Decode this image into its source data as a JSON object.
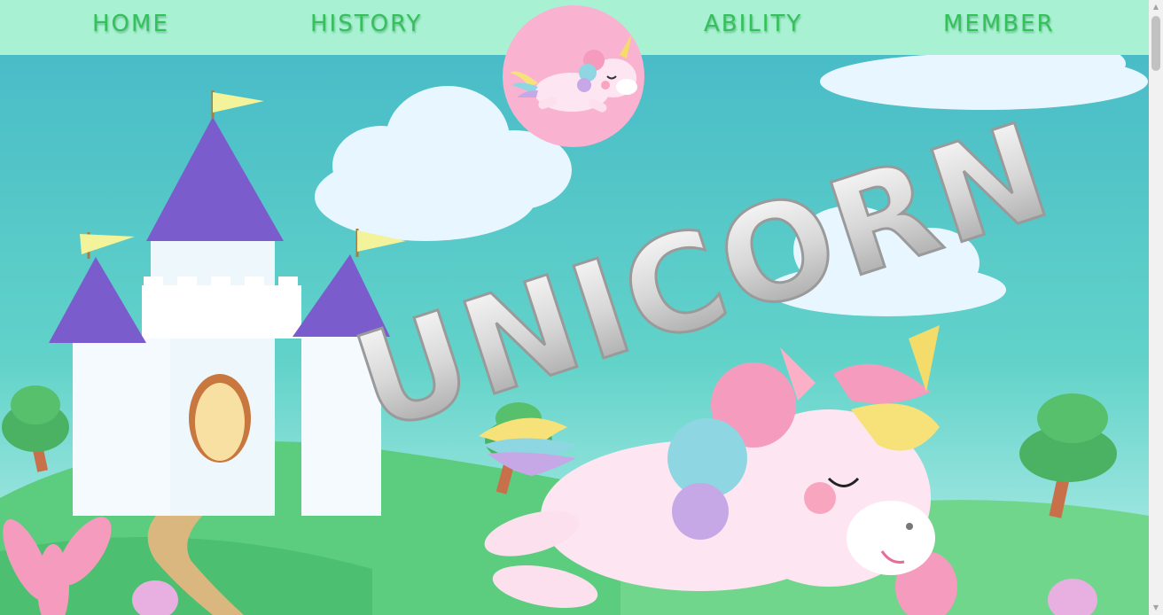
{
  "nav": {
    "home": "HOME",
    "history": "HISTORY",
    "ability": "ABILITY",
    "member": "MEMBER"
  },
  "hero": {
    "title": "UNICORN"
  },
  "colors": {
    "nav_bg": "#a8f2d3",
    "nav_text": "#35c05b",
    "logo_bg": "#f9b3d0",
    "sky": "#4fc4c8",
    "grass": "#5ccd7e"
  },
  "icons": {
    "logo": "unicorn-logo-icon",
    "scroll_up": "scroll-up-arrow-icon",
    "scroll_down": "scroll-down-arrow-icon"
  }
}
